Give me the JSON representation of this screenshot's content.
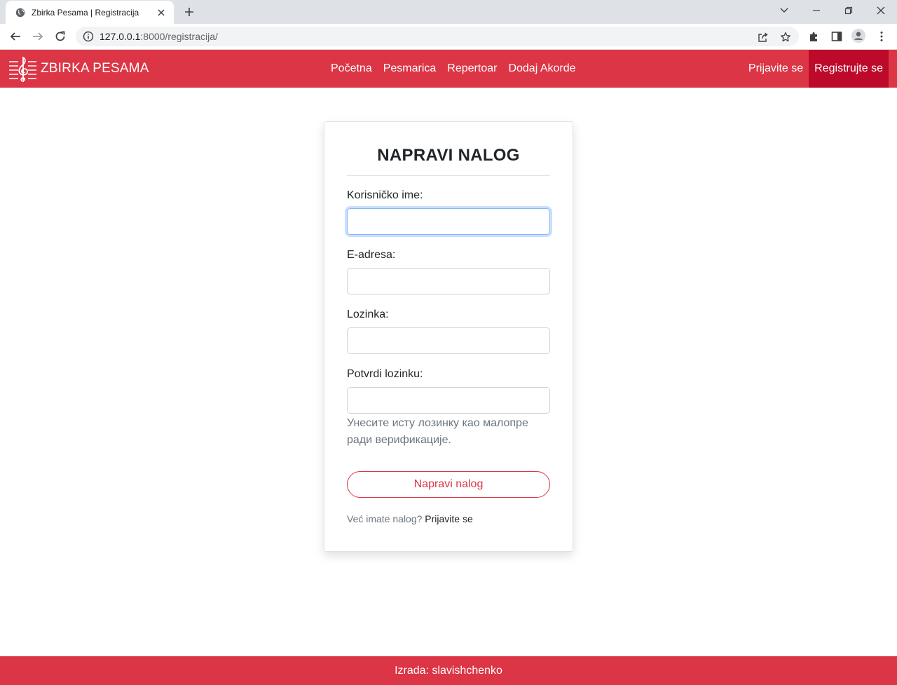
{
  "browser": {
    "tab_title": "Zbirka Pesama | Registracija",
    "url_host": "127.0.0.1",
    "url_rest": ":8000/registracija/"
  },
  "site": {
    "brand": "ZBIRKA PESAMA",
    "nav": [
      "Početna",
      "Pesmarica",
      "Repertoar",
      "Dodaj Akorde"
    ],
    "login": "Prijavite se",
    "register": "Registrujte se",
    "accent_color": "#dc3545",
    "active_color": "#bd0a2b"
  },
  "form": {
    "title": "NAPRAVI NALOG",
    "username_label": "Korisničko ime:",
    "username_value": "",
    "email_label": "E-adresa:",
    "email_value": "",
    "password_label": "Lozinka:",
    "password_value": "",
    "confirm_label": "Potvrdi lozinku:",
    "confirm_value": "",
    "confirm_help": "Унесите исту лозинку као малопре ради верификације.",
    "submit_label": "Napravi nalog",
    "login_prompt": "Već imate nalog?",
    "login_link": "Prijavite se"
  },
  "footer": {
    "text": "Izrada: slavishchenko"
  }
}
